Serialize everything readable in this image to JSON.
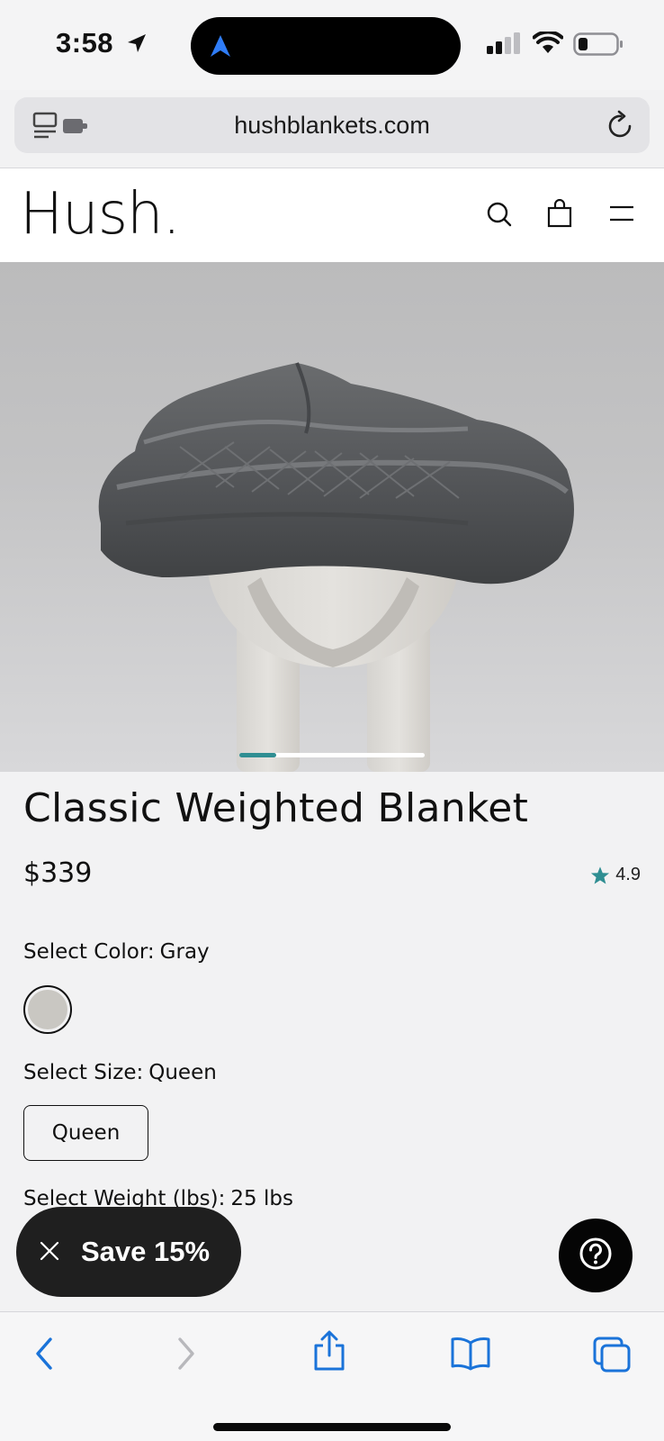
{
  "status_bar": {
    "time": "3:58"
  },
  "browser": {
    "url": "hushblankets.com"
  },
  "header": {
    "logo": "Hush."
  },
  "carousel": {
    "position_fraction": 0.2
  },
  "product": {
    "title": "Classic Weighted Blanket",
    "price": "$339",
    "rating": "4.9",
    "color_label": "Select Color:",
    "color_value": "Gray",
    "color_swatch_hex": "#c9c7c2",
    "size_label": "Select Size:",
    "size_value": "Queen",
    "size_option": "Queen",
    "weight_label": "Select Weight (lbs):",
    "weight_value": "25 lbs"
  },
  "promo": {
    "label": "Save 15%"
  },
  "colors": {
    "accent": "#2f8e92",
    "ios_blue": "#1a73d9",
    "ios_gray": "#b8b8bc"
  },
  "icons": {
    "status": [
      "location-arrow-icon",
      "signal-icon",
      "wifi-icon",
      "battery-icon"
    ],
    "header": [
      "search-icon",
      "bag-icon",
      "menu-icon"
    ],
    "toolbar": [
      "back-icon",
      "forward-icon",
      "share-icon",
      "bookmarks-icon",
      "tabs-icon"
    ]
  }
}
